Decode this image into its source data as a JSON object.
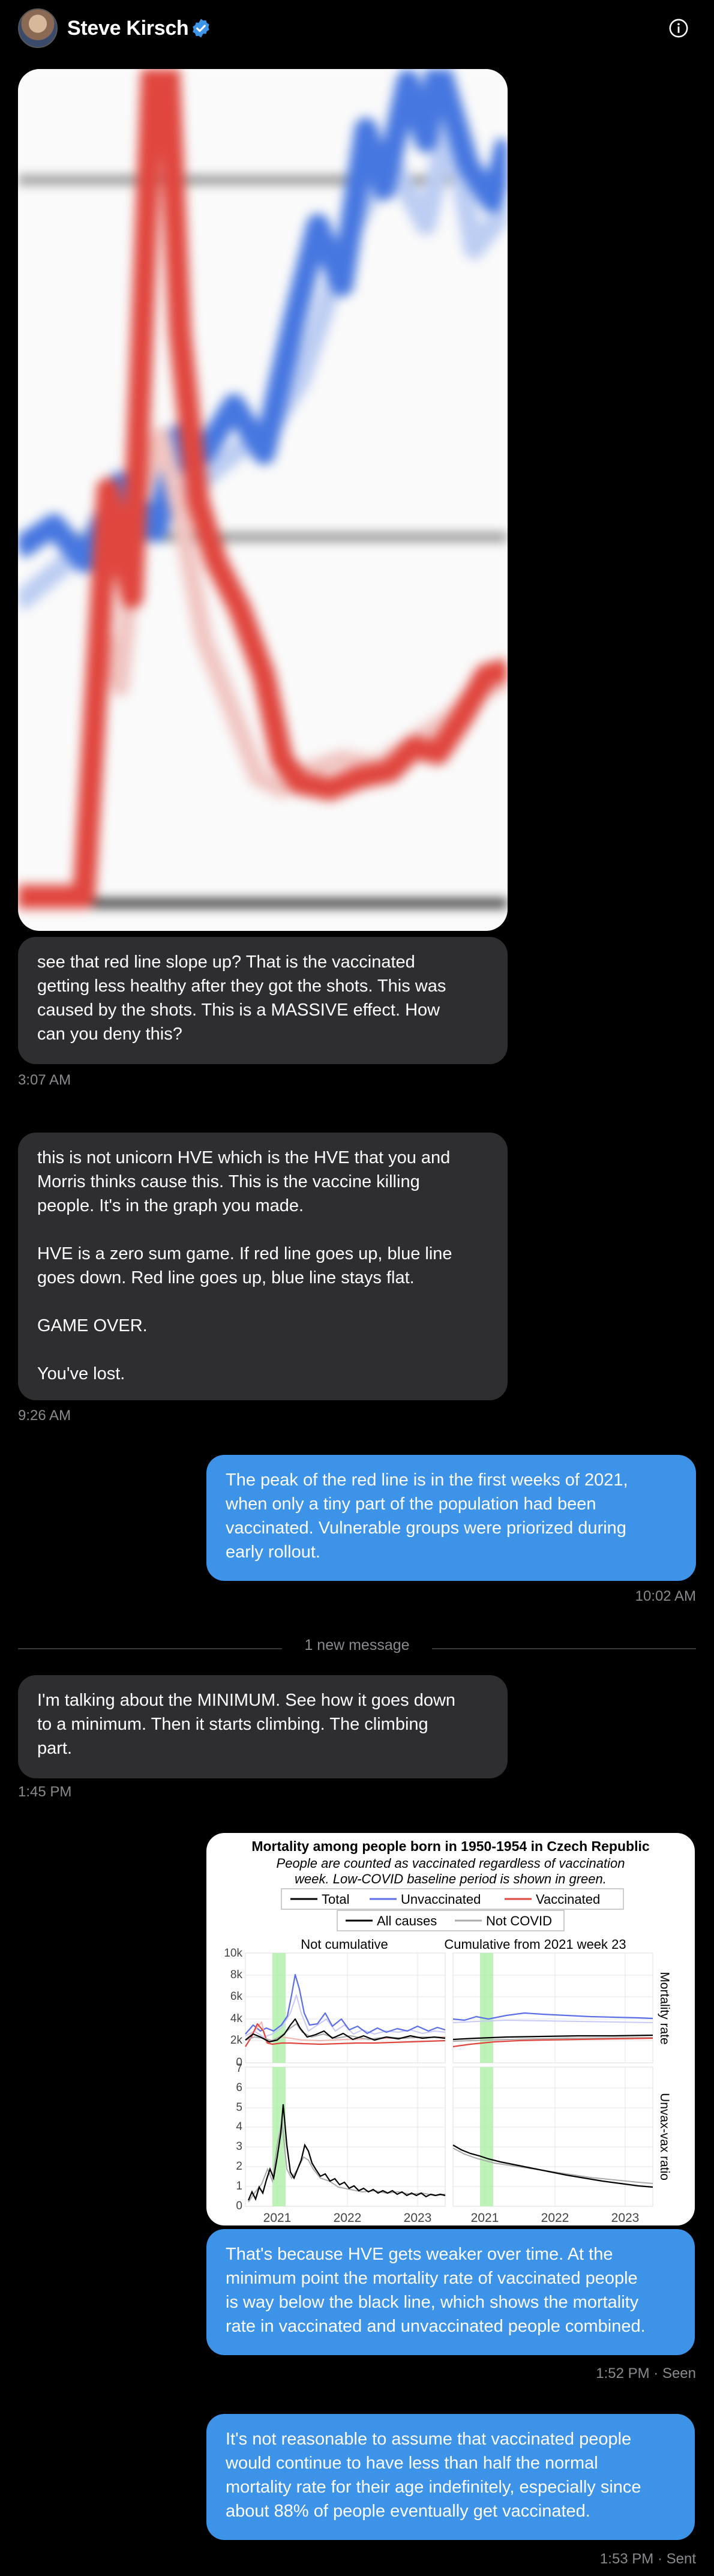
{
  "header": {
    "name": "Steve Kirsch"
  },
  "messages": [
    {
      "lines": [
        "see that red line slope up? That is the vaccinated",
        "getting less healthy after they got the shots. This was",
        "caused by the shots. This is a MASSIVE effect. How",
        "can you deny this?"
      ],
      "time": "3:07 AM"
    },
    {
      "lines": [
        "this is not unicorn HVE which is the HVE that you and",
        "Morris thinks cause this. This is the vaccine killing",
        "people. It's in the graph you made.",
        "",
        "HVE is a zero sum game. If red line goes up, blue line",
        "goes down. Red line goes up, blue line stays flat.",
        "",
        "GAME OVER.",
        "",
        "You've lost."
      ],
      "time": "9:26 AM"
    },
    {
      "lines": [
        "The peak of the red line is in the first weeks of 2021,",
        "when only a tiny part of the population had been",
        "vaccinated. Vulnerable groups were priorized during",
        "early rollout."
      ],
      "time": "10:02 AM"
    },
    {
      "lines": [
        "I'm talking about the MINIMUM. See how it goes down",
        "to a minimum. Then it starts climbing. The climbing",
        "part."
      ],
      "time": "1:45 PM"
    },
    {
      "lines": [
        "That's because HVE gets weaker over time. At the",
        "minimum point the mortality rate of vaccinated people",
        "is way below the black line, which shows the mortality",
        "rate in vaccinated and unvaccinated people combined."
      ],
      "time": "1:52 PM · Seen"
    },
    {
      "lines": [
        "It's not reasonable to assume that vaccinated people",
        "would continue to have less than half the normal",
        "mortality rate for their age indefinitely, especially since",
        "about 88% of people eventually get vaccinated."
      ],
      "time": "1:53 PM · Sent"
    }
  ],
  "divider": {
    "label": "1 new message"
  },
  "chart": {
    "title": "Mortality among people born in 1950-1954 in Czech Republic",
    "subtitle1": "People are counted as vaccinated regardless of vaccination",
    "subtitle2": "week. Low-COVID baseline period is shown in green.",
    "legend": {
      "total": "Total",
      "unvaccinated": "Unvaccinated",
      "vaccinated": "Vaccinated",
      "all_causes": "All causes",
      "not_covid": "Not COVID"
    },
    "panel_left": "Not cumulative",
    "panel_right": "Cumulative from 2021 week 23",
    "ylabel_top": "Mortality rate",
    "ylabel_bottom": "Unvax-vax ratio",
    "y_top_ticks": [
      "10k",
      "8k",
      "6k",
      "4k",
      "2k",
      "0"
    ],
    "y_bottom_ticks": [
      "7",
      "6",
      "5",
      "4",
      "3",
      "2",
      "1",
      "0"
    ],
    "x_ticks": [
      "2021",
      "2022",
      "2023"
    ]
  },
  "colors": {
    "incoming": "#2e2e30",
    "outgoing": "#3c93e8",
    "unvaccinated": "#5b6ee8",
    "vaccinated": "#e0463e",
    "total": "#000000",
    "baseline": "#a8eea0"
  }
}
